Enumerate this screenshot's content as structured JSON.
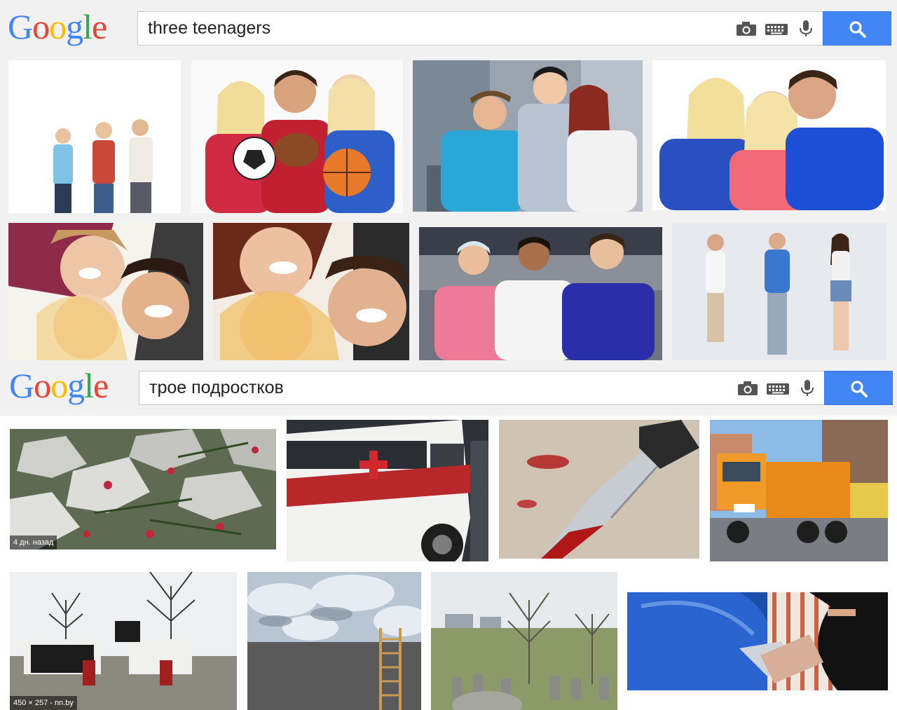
{
  "colors": {
    "logo_blue": "#4285f4",
    "logo_red": "#ea4335",
    "logo_yellow": "#fbbc05",
    "logo_green": "#34a853",
    "search_button": "#4285f4"
  },
  "logo_text": "Google",
  "panels": [
    {
      "query": "three teenagers",
      "icons": [
        "camera-icon",
        "keyboard-icon",
        "microphone-icon",
        "search-icon"
      ],
      "results": [
        {
          "subject": "three teenagers with backpacks on white background"
        },
        {
          "subject": "three teens holding soccer ball, football and basketball"
        },
        {
          "subject": "three teens posing on a street"
        },
        {
          "subject": "three smiling teens in pink and blue"
        },
        {
          "subject": "teens lying head to head looking up"
        },
        {
          "subject": "close-up of laughing teens"
        },
        {
          "subject": "three young men at a train station"
        },
        {
          "subject": "three teens standing in a bright room"
        }
      ]
    },
    {
      "query": "трое подростков",
      "icons": [
        "camera-icon",
        "keyboard-icon",
        "microphone-icon",
        "search-icon"
      ],
      "results": [
        {
          "subject": "flowers laid on rocks",
          "caption": "4 дн. назад"
        },
        {
          "subject": "ambulance van with red cross"
        },
        {
          "subject": "bloody knife"
        },
        {
          "subject": "orange trucks on a street"
        },
        {
          "subject": "memorial with dark wall",
          "caption": "450 × 257 - nn.by"
        },
        {
          "subject": "ladder against a wall under cloudy sky"
        },
        {
          "subject": "old cemetery with trees"
        },
        {
          "subject": "masked man breaking into a blue car"
        }
      ]
    }
  ]
}
